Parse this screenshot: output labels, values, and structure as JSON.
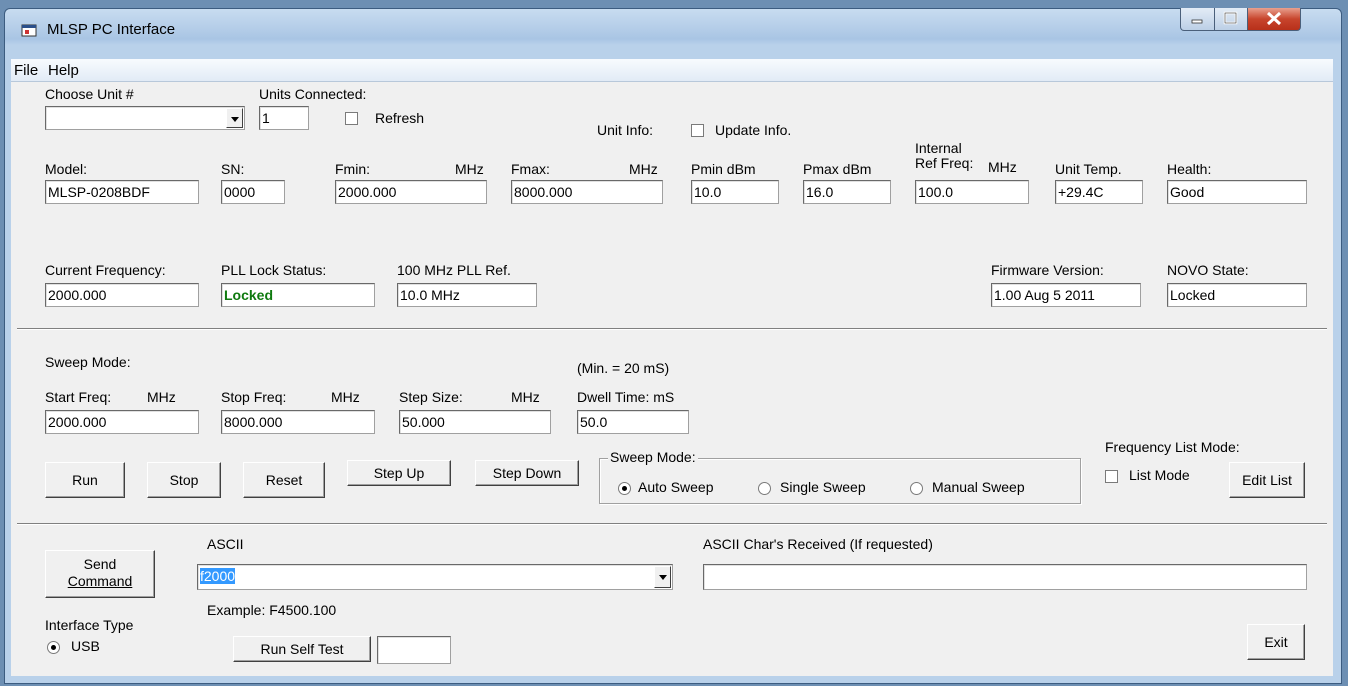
{
  "window": {
    "title": "MLSP PC Interface"
  },
  "menu": [
    "File",
    "Help"
  ],
  "unit": {
    "choose_label": "Choose Unit #",
    "units_connected_label": "Units Connected:",
    "units_connected_value": "1",
    "refresh_label": "Refresh",
    "unit_info_label": "Unit Info:",
    "update_info_label": "Update Info."
  },
  "info": {
    "model_label": "Model:",
    "model": "MLSP-0208BDF",
    "sn_label": "SN:",
    "sn": "0000",
    "fmin_label": "Fmin:",
    "fmin_unit": "MHz",
    "fmin": "2000.000",
    "fmax_label": "Fmax:",
    "fmax_unit": "MHz",
    "fmax": "8000.000",
    "pmin_label": "Pmin  dBm",
    "pmin": "10.0",
    "pmax_label": "Pmax  dBm",
    "pmax": "16.0",
    "ref_label_1": "Internal",
    "ref_label_2": "Ref Freq:",
    "ref_unit": "MHz",
    "ref": "100.0",
    "temp_label": "Unit Temp.",
    "temp": "+29.4C",
    "health_label": "Health:",
    "health": "Good",
    "cur_freq_label": "Current Frequency:",
    "cur_freq": "2000.000",
    "pll_label": "PLL Lock Status:",
    "pll": "Locked",
    "pll_ref_label": "100 MHz PLL Ref.",
    "pll_ref": "10.0 MHz",
    "fw_label": "Firmware Version:",
    "fw": "1.00 Aug 5 2011",
    "novo_label": "NOVO State:",
    "novo": "Locked"
  },
  "sweep": {
    "section_label": "Sweep Mode:",
    "start_label": "Start Freq:",
    "start_unit": "MHz",
    "start": "2000.000",
    "stop_label": "Stop Freq:",
    "stop_unit": "MHz",
    "stop": "8000.000",
    "step_label": "Step Size:",
    "step_unit": "MHz",
    "step": "50.000",
    "dwell_note": "(Min. = 20 mS)",
    "dwell_label": "Dwell Time:  mS",
    "dwell": "50.0",
    "run": "Run",
    "stop_btn": "Stop",
    "reset": "Reset",
    "step_up": "Step Up",
    "step_down": "Step Down",
    "mode_group": "Sweep Mode:",
    "auto": "Auto Sweep",
    "single": "Single Sweep",
    "manual": "Manual Sweep",
    "list_mode_title": "Frequency List Mode:",
    "list_mode": "List Mode",
    "edit_list": "Edit List"
  },
  "command": {
    "send_1": "Send",
    "send_2": "Command",
    "ascii_label": "ASCII",
    "ascii_value": "f2000",
    "example": "Example: F4500.100",
    "received_label": "ASCII Char's Received (If requested)",
    "received": "",
    "iface_label": "Interface Type",
    "usb": "USB",
    "self_test": "Run Self Test",
    "self_test_result": "",
    "exit": "Exit"
  },
  "colors": {
    "locked_green": "#0f7a0f",
    "selection": "#3399ff"
  }
}
